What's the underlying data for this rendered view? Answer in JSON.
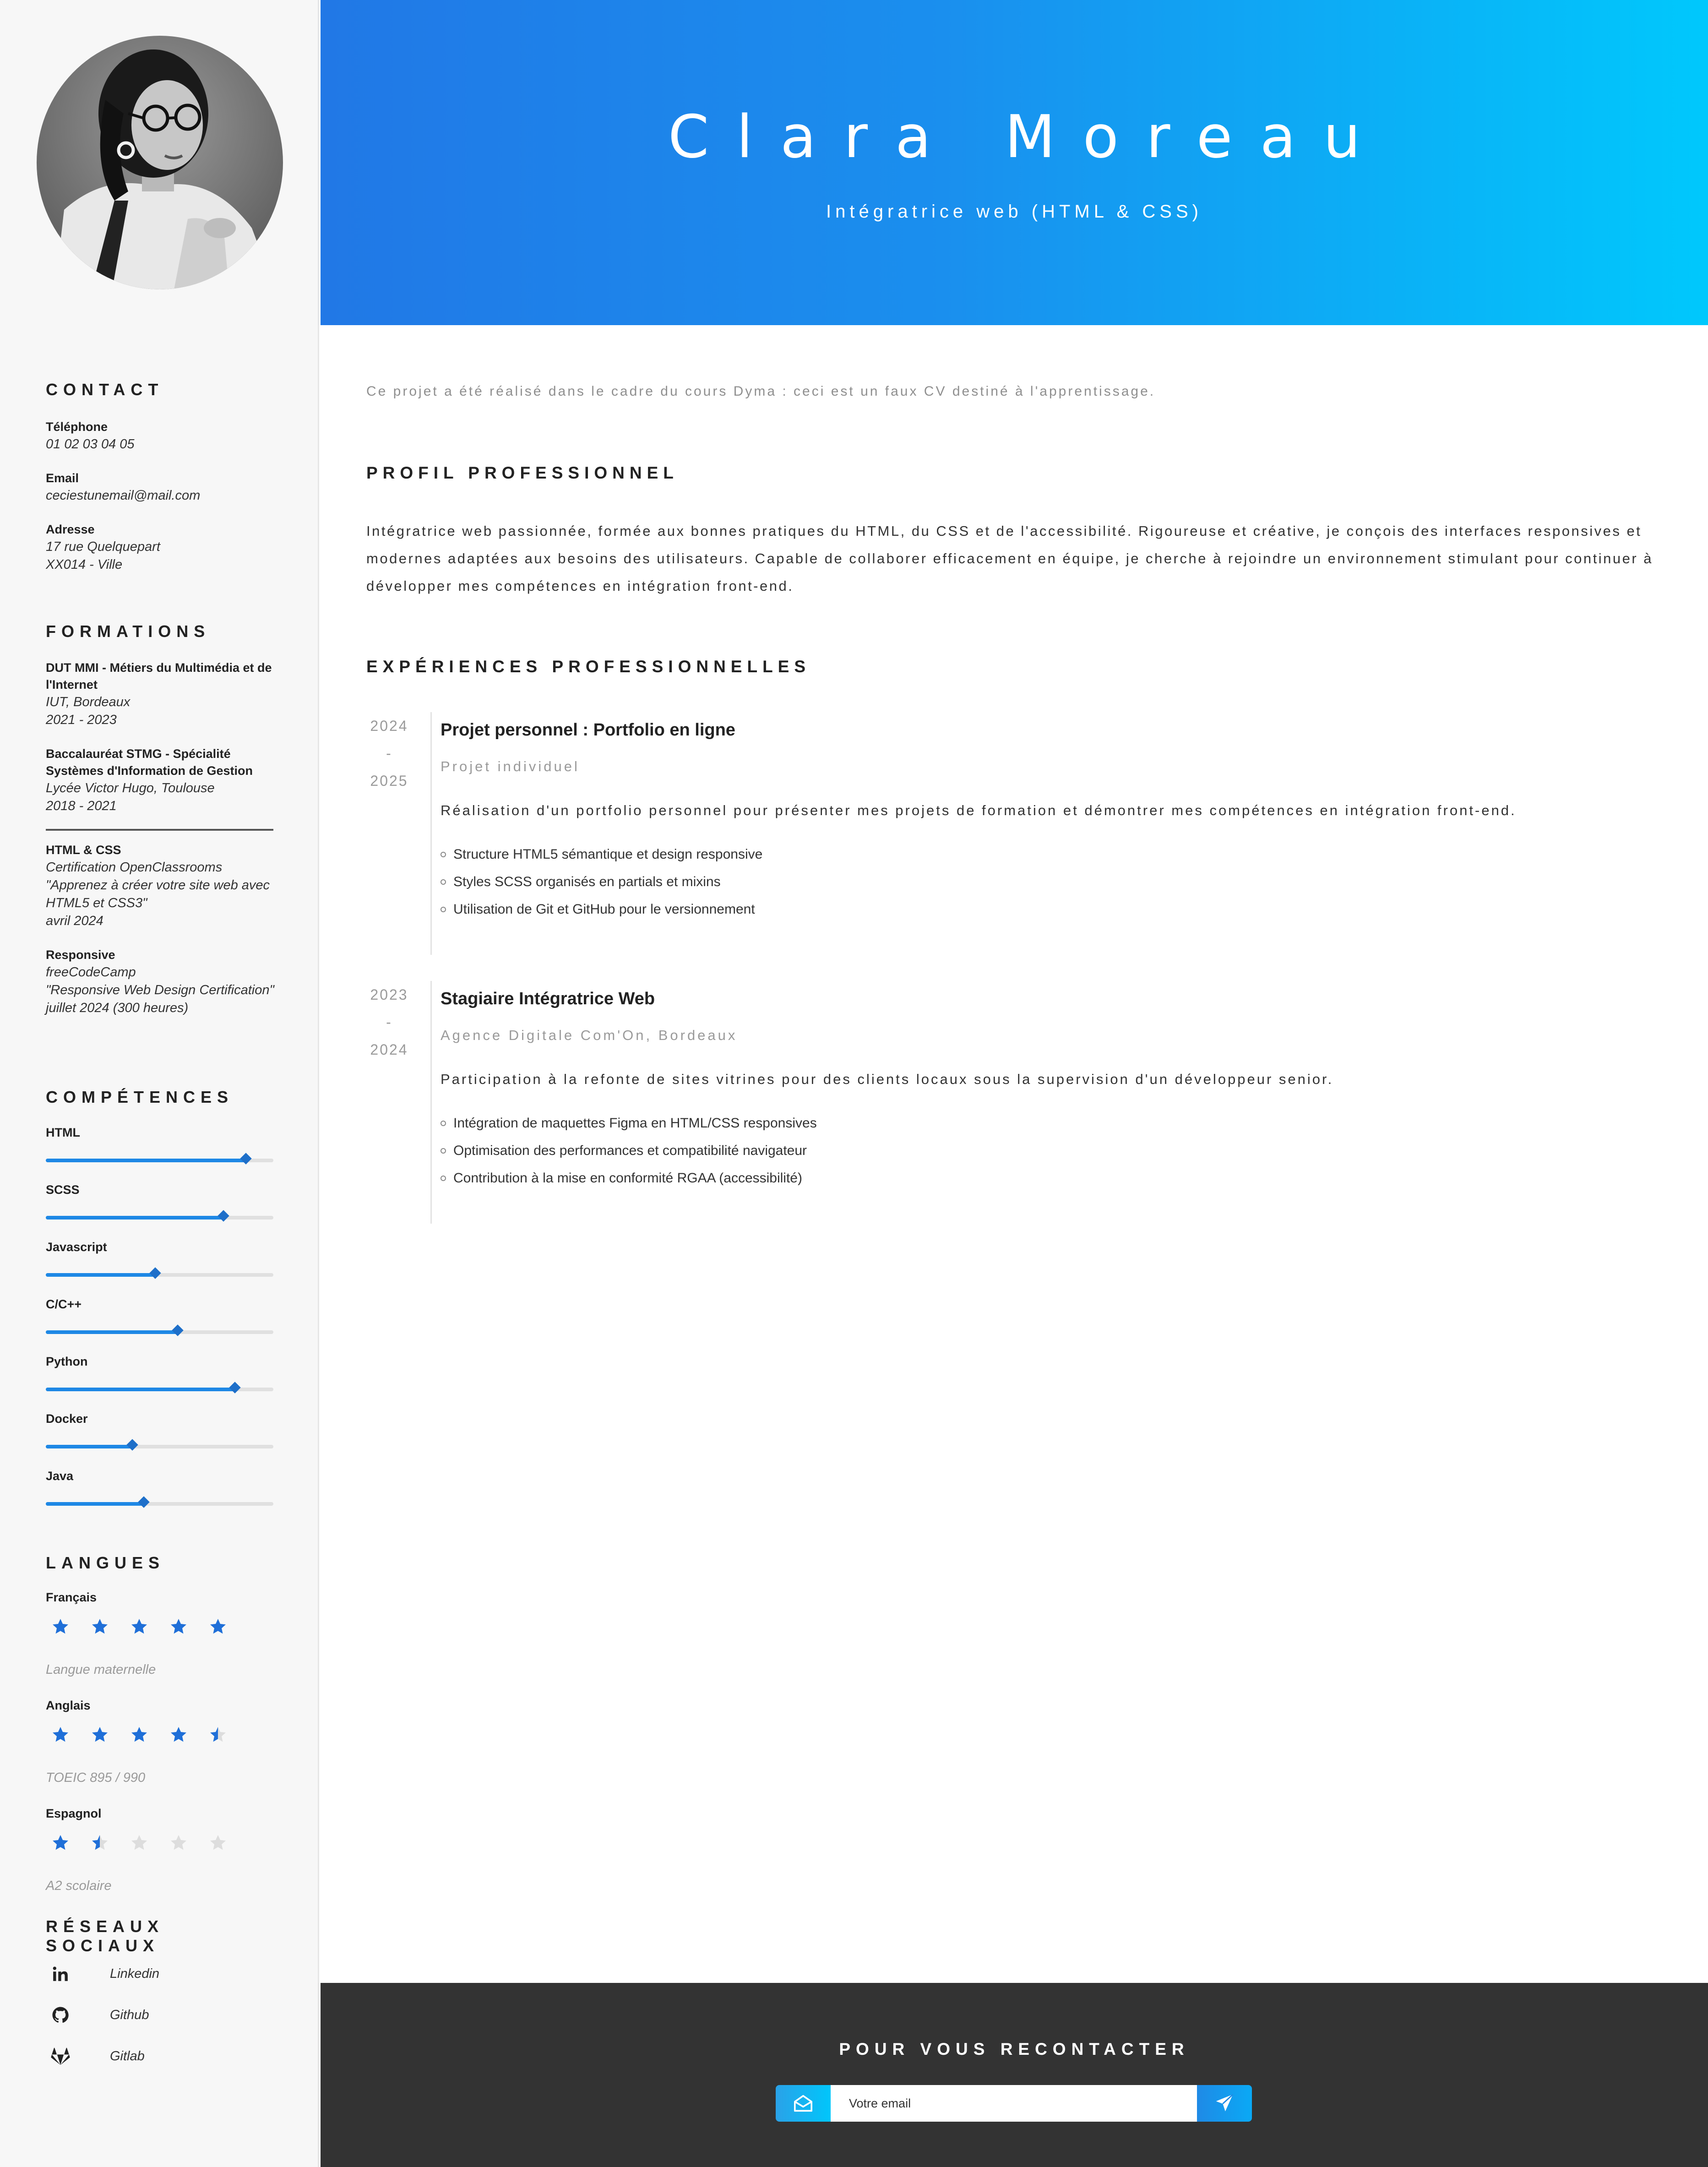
{
  "header": {
    "name": "Clara Moreau",
    "job_title": "Intégratrice web (HTML & CSS)"
  },
  "sidebar": {
    "photo_alt": "Photo de Clara Moreau",
    "contact": {
      "title": "CONTACT",
      "items": [
        {
          "label": "Téléphone",
          "lines": [
            "01 02 03 04 05"
          ]
        },
        {
          "label": "Email",
          "lines": [
            "ceciestunemail@mail.com"
          ]
        },
        {
          "label": "Adresse",
          "lines": [
            "17 rue Quelquepart",
            "XX014 - Ville"
          ]
        }
      ]
    },
    "formations": {
      "title": "FORMATIONS",
      "items": [
        {
          "title": "DUT MMI - Métiers du Multimédia et de l'Internet",
          "lines": [
            "IUT, Bordeaux",
            "2021 - 2023"
          ]
        },
        {
          "title": "Baccalauréat STMG - Spécialité Systèmes d'Information de Gestion",
          "lines": [
            "Lycée Victor Hugo, Toulouse",
            "2018 - 2021"
          ]
        },
        {
          "title": "HTML & CSS",
          "lines": [
            "Certification OpenClassrooms",
            "\"Apprenez à créer votre site web avec HTML5 et CSS3\"",
            "avril 2024"
          ]
        },
        {
          "title": "Responsive",
          "lines": [
            "freeCodeCamp",
            "\"Responsive Web Design Certification\"",
            "juillet 2024 (300 heures)"
          ]
        }
      ]
    },
    "competences": {
      "title": "COMPÉTENCES",
      "items": [
        {
          "name": "HTML",
          "level": 0.88
        },
        {
          "name": "SCSS",
          "level": 0.78
        },
        {
          "name": "Javascript",
          "level": 0.48
        },
        {
          "name": "C/C++",
          "level": 0.58
        },
        {
          "name": "Python",
          "level": 0.83
        },
        {
          "name": "Docker",
          "level": 0.38
        },
        {
          "name": "Java",
          "level": 0.43
        }
      ]
    },
    "langues": {
      "title": "LANGUES",
      "items": [
        {
          "name": "Français",
          "stars": 5,
          "note": "Langue maternelle"
        },
        {
          "name": "Anglais",
          "stars": 4.5,
          "note": "TOEIC 895 / 990"
        },
        {
          "name": "Espagnol",
          "stars": 1.5,
          "note": "A2 scolaire"
        }
      ],
      "star_color": "#1f6fd8",
      "star_empty_color": "#dddddd"
    },
    "reseaux": {
      "title": "RÉSEAUX SOCIAUX",
      "items": [
        {
          "icon": "linkedin-icon",
          "label": "Linkedin"
        },
        {
          "icon": "github-icon",
          "label": "Github"
        },
        {
          "icon": "gitlab-icon",
          "label": "Gitlab"
        }
      ]
    }
  },
  "main": {
    "note": "Ce projet a été réalisé dans le cadre du cours Dyma : ceci est un faux CV destiné à l'apprentissage.",
    "profil": {
      "title": "PROFIL PROFESSIONNEL",
      "text": "Intégratrice web passionnée, formée aux bonnes pratiques du HTML, du CSS et de l'accessibilité. Rigoureuse et créative, je conçois des interfaces responsives et modernes adaptées aux besoins des utilisateurs. Capable de collaborer efficacement en équipe, je cherche à rejoindre un environnement stimulant pour continuer à développer mes compétences en intégration front-end."
    },
    "experiences": {
      "title": "EXPÉRIENCES PROFESSIONNELLES",
      "items": [
        {
          "year_start": "2024",
          "sep": "-",
          "year_end": "2025",
          "title": "Projet personnel : Portfolio en ligne",
          "subtitle": "Projet individuel",
          "description": "Réalisation d'un portfolio personnel pour présenter mes projets de formation et démontrer mes compétences en intégration front-end.",
          "bullets": [
            "Structure HTML5 sémantique et design responsive",
            "Styles SCSS organisés en partials et mixins",
            "Utilisation de Git et GitHub pour le versionnement"
          ]
        },
        {
          "year_start": "2023",
          "sep": "-",
          "year_end": "2024",
          "title": "Stagiaire Intégratrice Web",
          "subtitle": "Agence Digitale Com'On, Bordeaux",
          "description": "Participation à la refonte de sites vitrines pour des clients locaux sous la supervision d'un développeur senior.",
          "bullets": [
            "Intégration de maquettes Figma en HTML/CSS responsives",
            "Optimisation des performances et compatibilité navigateur",
            "Contribution à la mise en conformité RGAA (accessibilité)"
          ]
        }
      ]
    }
  },
  "footer": {
    "title": "POUR VOUS RECONTACTER",
    "email_placeholder": "Votre email"
  },
  "colors": {
    "header_gradient_start": "#2178e6",
    "header_gradient_end": "#00c8fc",
    "accent": "#1e88e5",
    "footer_bg": "#333333"
  }
}
